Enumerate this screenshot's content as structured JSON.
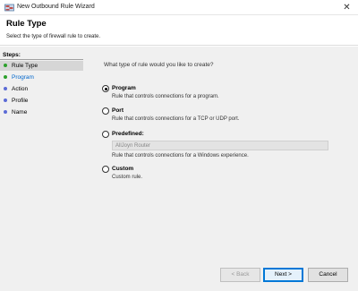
{
  "window": {
    "title": "New Outbound Rule Wizard",
    "close_glyph": "✕"
  },
  "header": {
    "title": "Rule Type",
    "subtitle": "Select the type of firewall rule to create."
  },
  "steps": {
    "label": "Steps:",
    "items": [
      {
        "label": "Rule Type",
        "current": true,
        "dot_color": "#2ca02c"
      },
      {
        "label": "Program",
        "current": false,
        "dot_color": "#2ca02c"
      },
      {
        "label": "Action",
        "current": false,
        "dot_color": "#5b6bd6"
      },
      {
        "label": "Profile",
        "current": false,
        "dot_color": "#5b6bd6"
      },
      {
        "label": "Name",
        "current": false,
        "dot_color": "#5b6bd6"
      }
    ]
  },
  "main": {
    "question": "What type of rule would you like to create?",
    "options": [
      {
        "label": "Program",
        "desc": "Rule that controls connections for a program.",
        "checked": true
      },
      {
        "label": "Port",
        "desc": "Rule that controls connections for a TCP or UDP port.",
        "checked": false
      },
      {
        "label": "Predefined:",
        "select_value": "AllJoyn Router",
        "desc": "Rule that controls connections for a Windows experience.",
        "checked": false
      },
      {
        "label": "Custom",
        "desc": "Custom rule.",
        "checked": false
      }
    ]
  },
  "buttons": {
    "back": "< Back",
    "next": "Next >",
    "cancel": "Cancel"
  },
  "icons": {
    "app": "firewall-wizard-icon"
  }
}
